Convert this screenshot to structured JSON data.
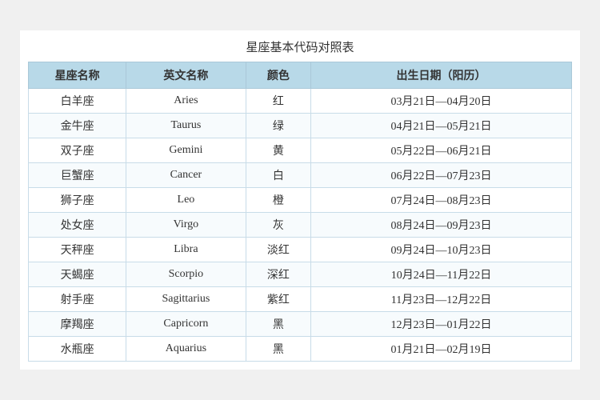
{
  "title": "星座基本代码对照表",
  "headers": {
    "zh_name": "星座名称",
    "en_name": "英文名称",
    "color": "颜色",
    "date": "出生日期（阳历）"
  },
  "rows": [
    {
      "zh": "白羊座",
      "en": "Aries",
      "color": "红",
      "date": "03月21日—04月20日"
    },
    {
      "zh": "金牛座",
      "en": "Taurus",
      "color": "绿",
      "date": "04月21日—05月21日"
    },
    {
      "zh": "双子座",
      "en": "Gemini",
      "color": "黄",
      "date": "05月22日—06月21日"
    },
    {
      "zh": "巨蟹座",
      "en": "Cancer",
      "color": "白",
      "date": "06月22日—07月23日"
    },
    {
      "zh": "狮子座",
      "en": "Leo",
      "color": "橙",
      "date": "07月24日—08月23日"
    },
    {
      "zh": "处女座",
      "en": "Virgo",
      "color": "灰",
      "date": "08月24日—09月23日"
    },
    {
      "zh": "天秤座",
      "en": "Libra",
      "color": "淡红",
      "date": "09月24日—10月23日"
    },
    {
      "zh": "天蝎座",
      "en": "Scorpio",
      "color": "深红",
      "date": "10月24日—11月22日"
    },
    {
      "zh": "射手座",
      "en": "Sagittarius",
      "color": "紫红",
      "date": "11月23日—12月22日"
    },
    {
      "zh": "摩羯座",
      "en": "Capricorn",
      "color": "黑",
      "date": "12月23日—01月22日"
    },
    {
      "zh": "水瓶座",
      "en": "Aquarius",
      "color": "黑",
      "date": "01月21日—02月19日"
    }
  ]
}
